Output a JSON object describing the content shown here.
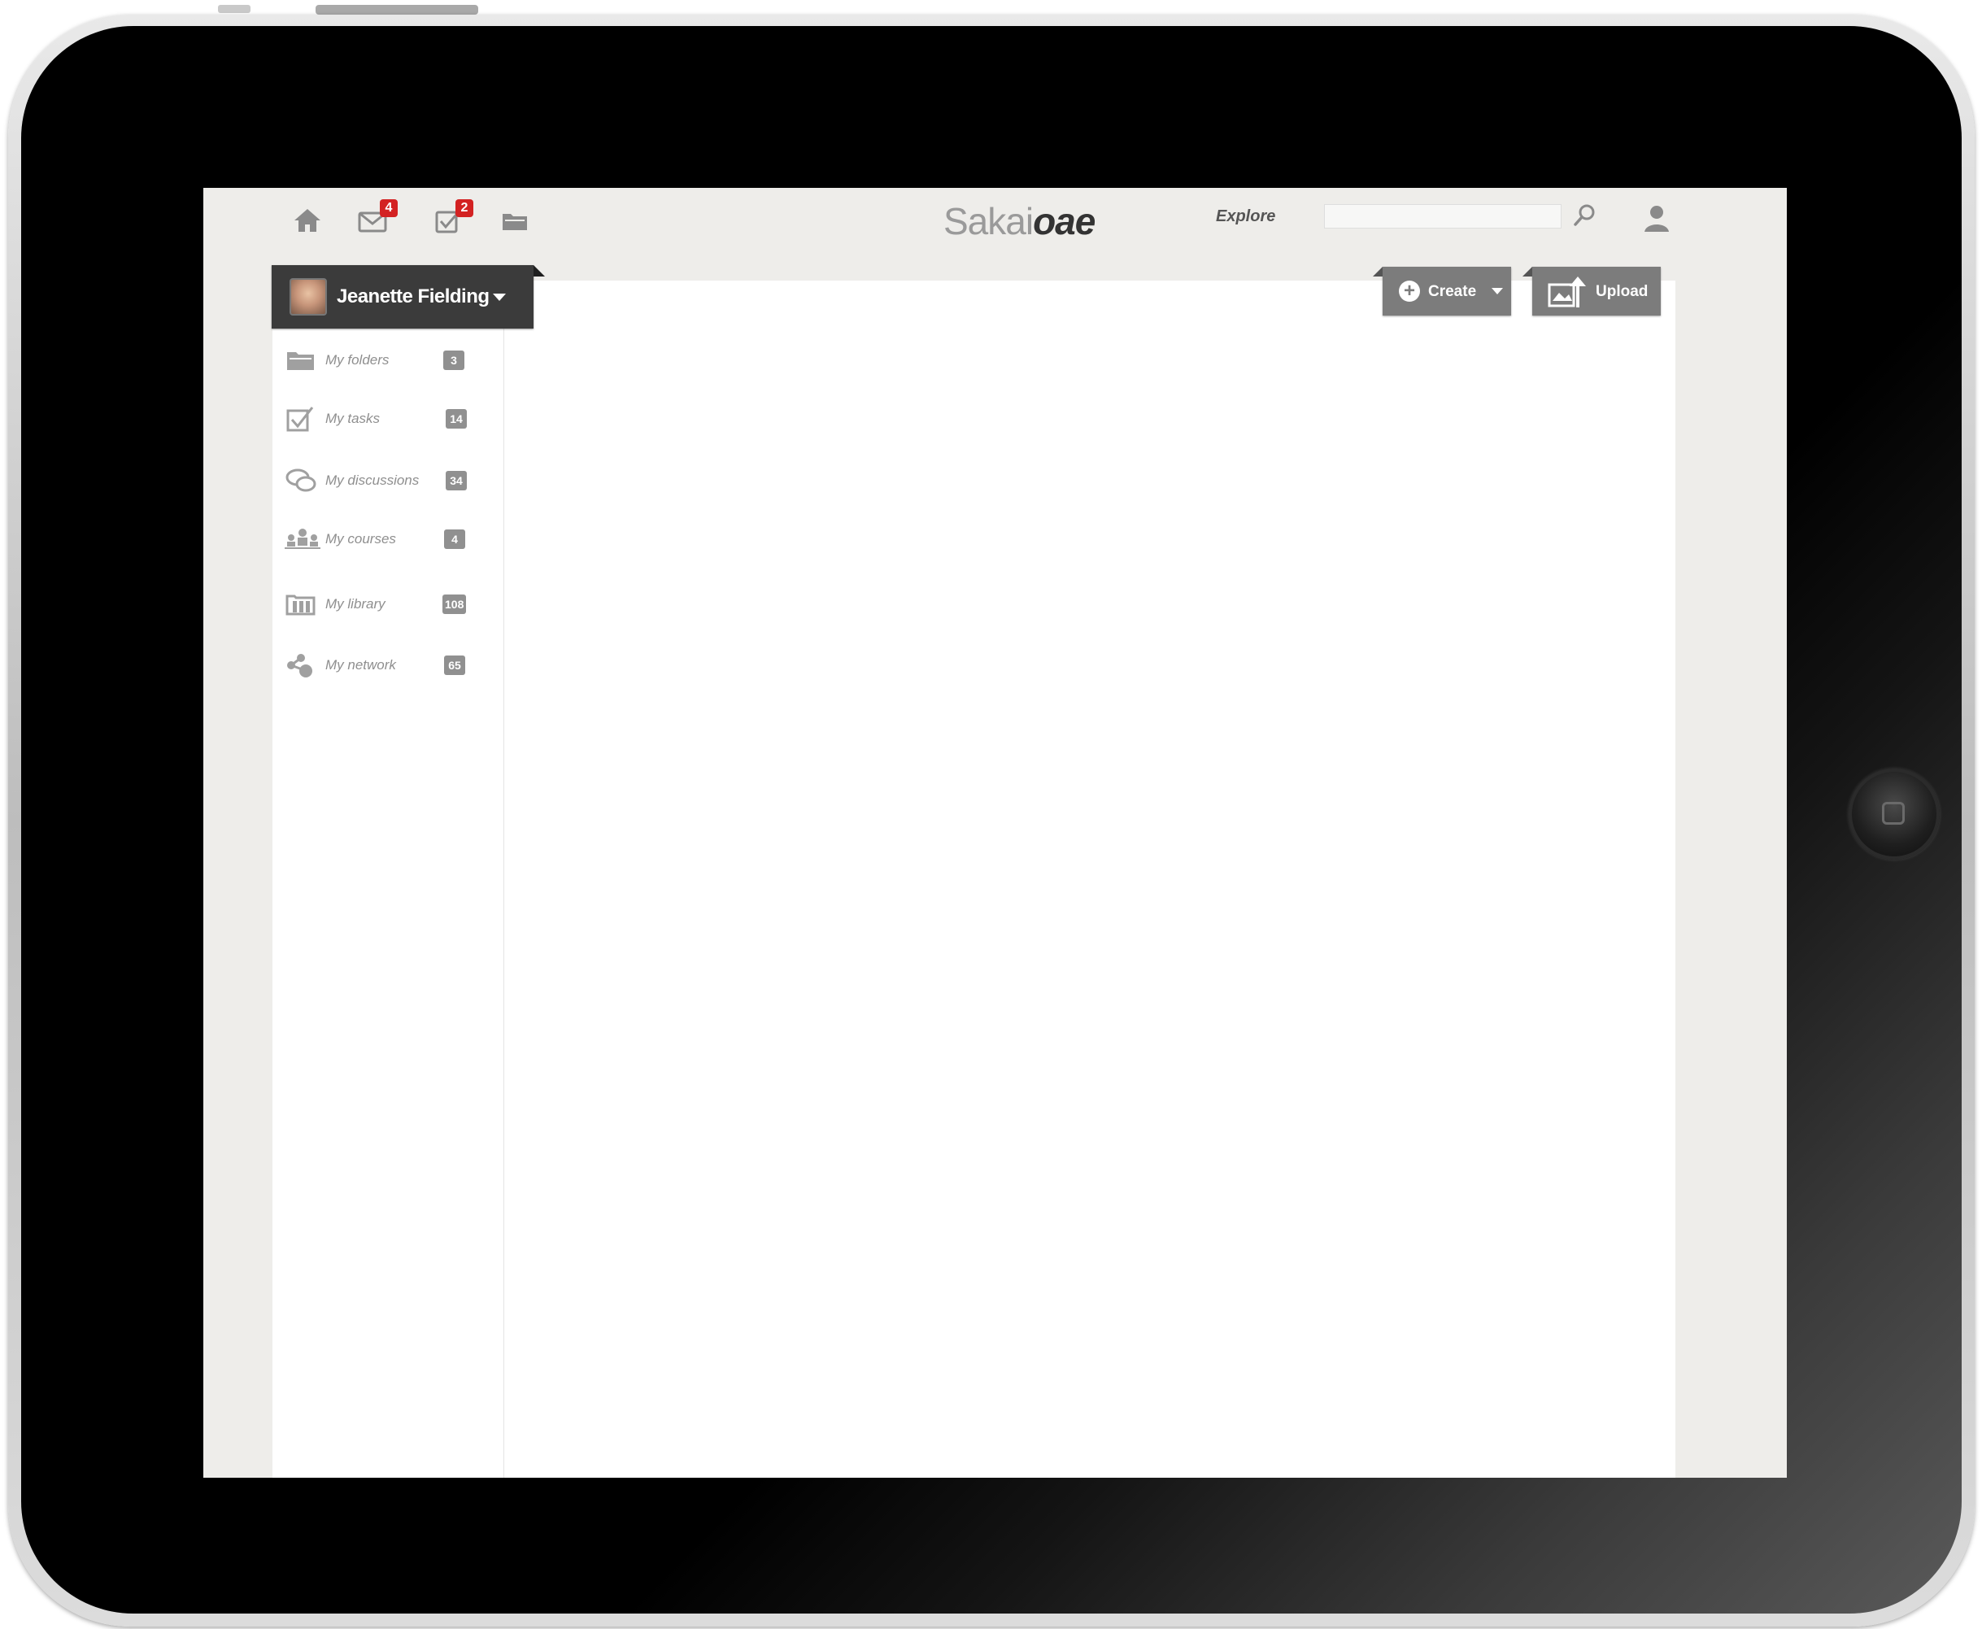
{
  "topbar": {
    "nav": [
      {
        "name": "home",
        "icon": "home-icon"
      },
      {
        "name": "messages",
        "icon": "envelope-icon",
        "badge": "4"
      },
      {
        "name": "tasks",
        "icon": "checkbox-icon",
        "badge": "2"
      },
      {
        "name": "folders",
        "icon": "folder-icon"
      }
    ],
    "logo_light": "Sakai",
    "logo_bold": "oae",
    "explore_label": "Explore",
    "search_value": "",
    "search_icon": "search-icon",
    "user_icon": "user-icon"
  },
  "user_menu": {
    "name": "Jeanette Fielding",
    "avatar_icon": "avatar"
  },
  "sidebar": {
    "items": [
      {
        "label": "My folders",
        "count": "3",
        "icon": "folder-icon"
      },
      {
        "label": "My tasks",
        "count": "14",
        "icon": "checkbox-icon"
      },
      {
        "label": "My discussions",
        "count": "34",
        "icon": "chat-bubbles-icon"
      },
      {
        "label": "My courses",
        "count": "4",
        "icon": "people-icon"
      },
      {
        "label": "My library",
        "count": "108",
        "icon": "library-icon"
      },
      {
        "label": "My network",
        "count": "65",
        "icon": "network-icon"
      }
    ]
  },
  "actions": {
    "create_label": "Create",
    "upload_label": "Upload"
  },
  "colors": {
    "badge_red": "#d32222",
    "header_bg": "#eeedea",
    "menu_dark": "#3b3b3b",
    "button_grey": "#7c7c7c"
  }
}
